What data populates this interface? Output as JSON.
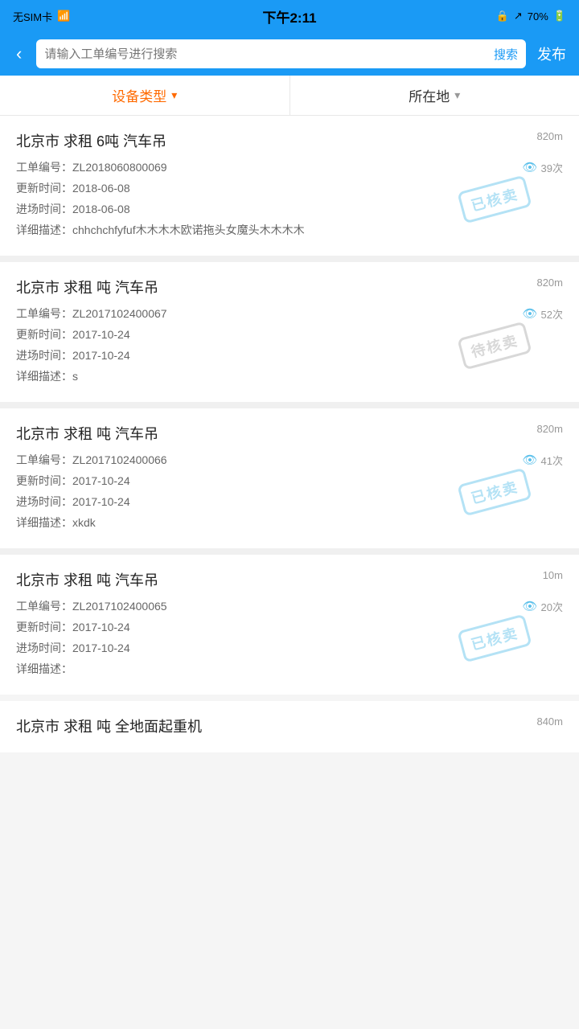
{
  "statusBar": {
    "left": "无SIM卡 ☁",
    "center": "下午2:11",
    "right": "70%"
  },
  "navBar": {
    "backLabel": "‹",
    "searchPlaceholder": "请输入工单编号进行搜索",
    "searchBtnLabel": "搜索",
    "publishLabel": "发布"
  },
  "filterBar": {
    "deviceTypeLabel": "设备类型",
    "locationLabel": "所在地"
  },
  "cards": [
    {
      "title": "北京市 求租 6吨 汽车吊",
      "distance": "820m",
      "orderLabel": "工单编号：",
      "orderNo": "ZL2018060800069",
      "views": "39次",
      "updateLabel": "更新时间：",
      "updateTime": "2018-06-08",
      "entryLabel": "进场时间：",
      "entryTime": "2018-06-08",
      "descLabel": "详细描述：",
      "desc": "chhchchfyfuf木木木木欧诺拖头女魔头木木木木",
      "stamp": "已核卖",
      "stampType": "sold"
    },
    {
      "title": "北京市 求租 吨 汽车吊",
      "distance": "820m",
      "orderLabel": "工单编号：",
      "orderNo": "ZL2017102400067",
      "views": "52次",
      "updateLabel": "更新时间：",
      "updateTime": "2017-10-24",
      "entryLabel": "进场时间：",
      "entryTime": "2017-10-24",
      "descLabel": "详细描述：",
      "desc": "s",
      "stamp": "待核卖",
      "stampType": "pending"
    },
    {
      "title": "北京市 求租 吨 汽车吊",
      "distance": "820m",
      "orderLabel": "工单编号：",
      "orderNo": "ZL2017102400066",
      "views": "41次",
      "updateLabel": "更新时间：",
      "updateTime": "2017-10-24",
      "entryLabel": "进场时间：",
      "entryTime": "2017-10-24",
      "descLabel": "详细描述：",
      "desc": "xkdk",
      "stamp": "已核卖",
      "stampType": "sold"
    },
    {
      "title": "北京市 求租 吨 汽车吊",
      "distance": "10m",
      "orderLabel": "工单编号：",
      "orderNo": "ZL2017102400065",
      "views": "20次",
      "updateLabel": "更新时间：",
      "updateTime": "2017-10-24",
      "entryLabel": "进场时间：",
      "entryTime": "2017-10-24",
      "descLabel": "详细描述：",
      "desc": "",
      "stamp": "已核卖",
      "stampType": "sold"
    }
  ],
  "partialCard": {
    "title": "北京市 求租 吨 全地面起重机",
    "distance": "840m"
  }
}
